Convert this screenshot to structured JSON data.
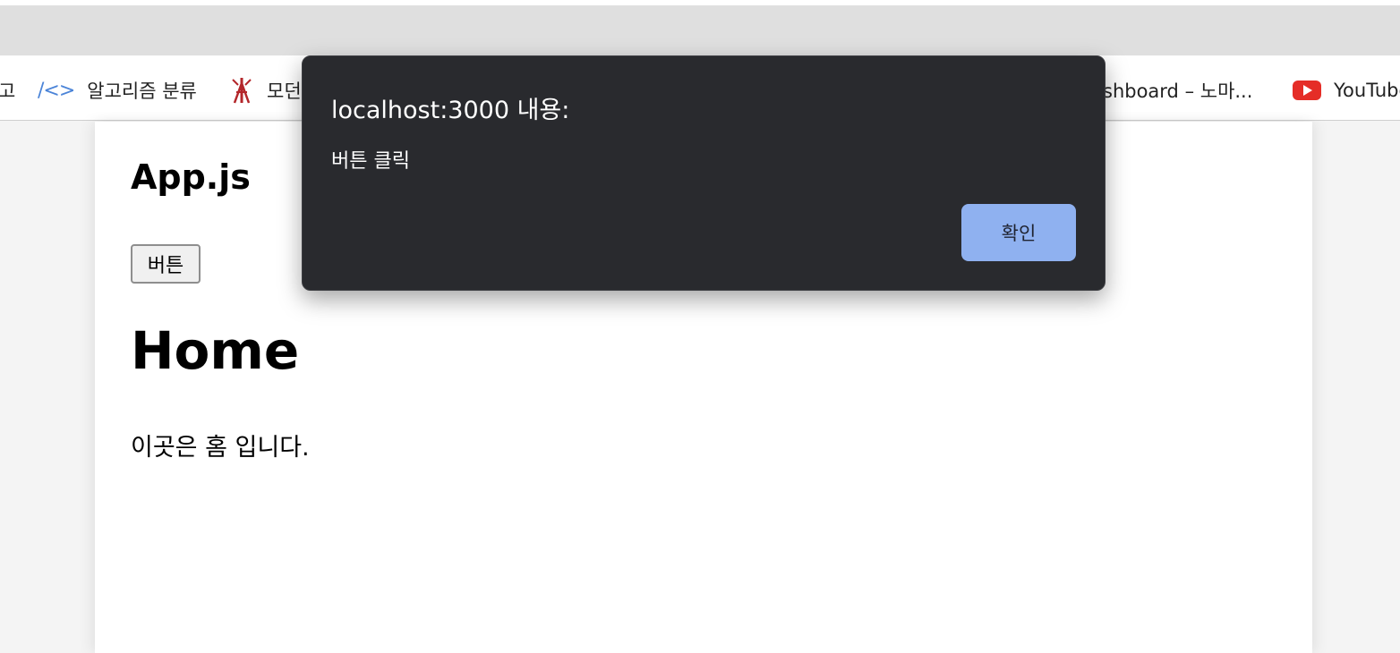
{
  "bookmarks": [
    {
      "label": "고",
      "icon": "none"
    },
    {
      "label": "알고리즘 분류",
      "icon": "code-icon"
    },
    {
      "label": "모던",
      "icon": "tower-icon"
    },
    {
      "label": "shboard – 노마...",
      "icon": "none"
    },
    {
      "label": "YouTube",
      "icon": "youtube-icon"
    }
  ],
  "page": {
    "app_title": "App.js",
    "button_label": "버튼",
    "home_heading": "Home",
    "home_text": "이곳은 홈 입니다."
  },
  "dialog": {
    "title": "localhost:3000 내용:",
    "message": "버튼 클릭",
    "ok_label": "확인",
    "ok_color": "#8fb1f0",
    "background_color": "#292a2e"
  }
}
